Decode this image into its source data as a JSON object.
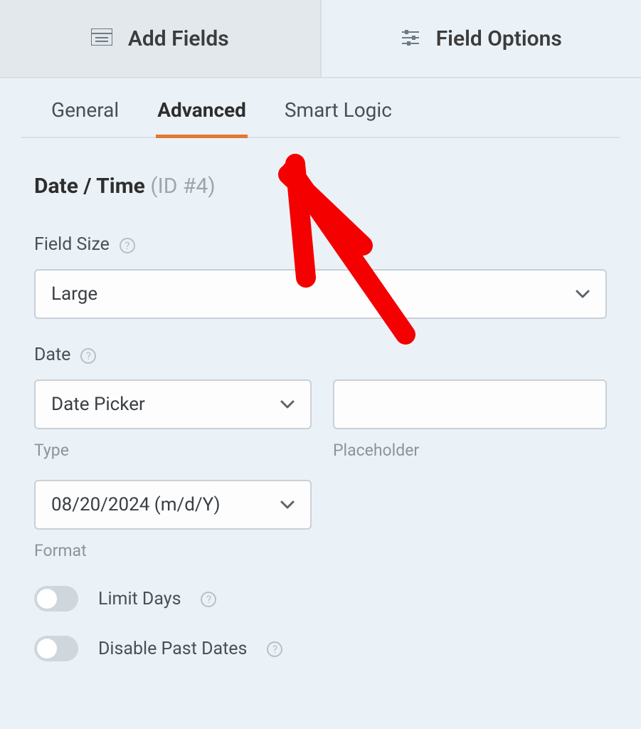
{
  "topTabs": {
    "addFields": "Add Fields",
    "fieldOptions": "Field Options"
  },
  "subTabs": {
    "general": "General",
    "advanced": "Advanced",
    "smartLogic": "Smart Logic",
    "active": "advanced"
  },
  "field": {
    "titleName": "Date / Time",
    "titleId": "(ID #4)"
  },
  "fieldSize": {
    "label": "Field Size",
    "value": "Large"
  },
  "date": {
    "label": "Date",
    "typeValue": "Date Picker",
    "typeSubLabel": "Type",
    "placeholderValue": "",
    "placeholderSubLabel": "Placeholder",
    "formatValue": "08/20/2024 (m/d/Y)",
    "formatSubLabel": "Format"
  },
  "toggles": {
    "limitDays": "Limit Days",
    "disablePast": "Disable Past Dates"
  },
  "annotation": {
    "color": "#f40000"
  }
}
